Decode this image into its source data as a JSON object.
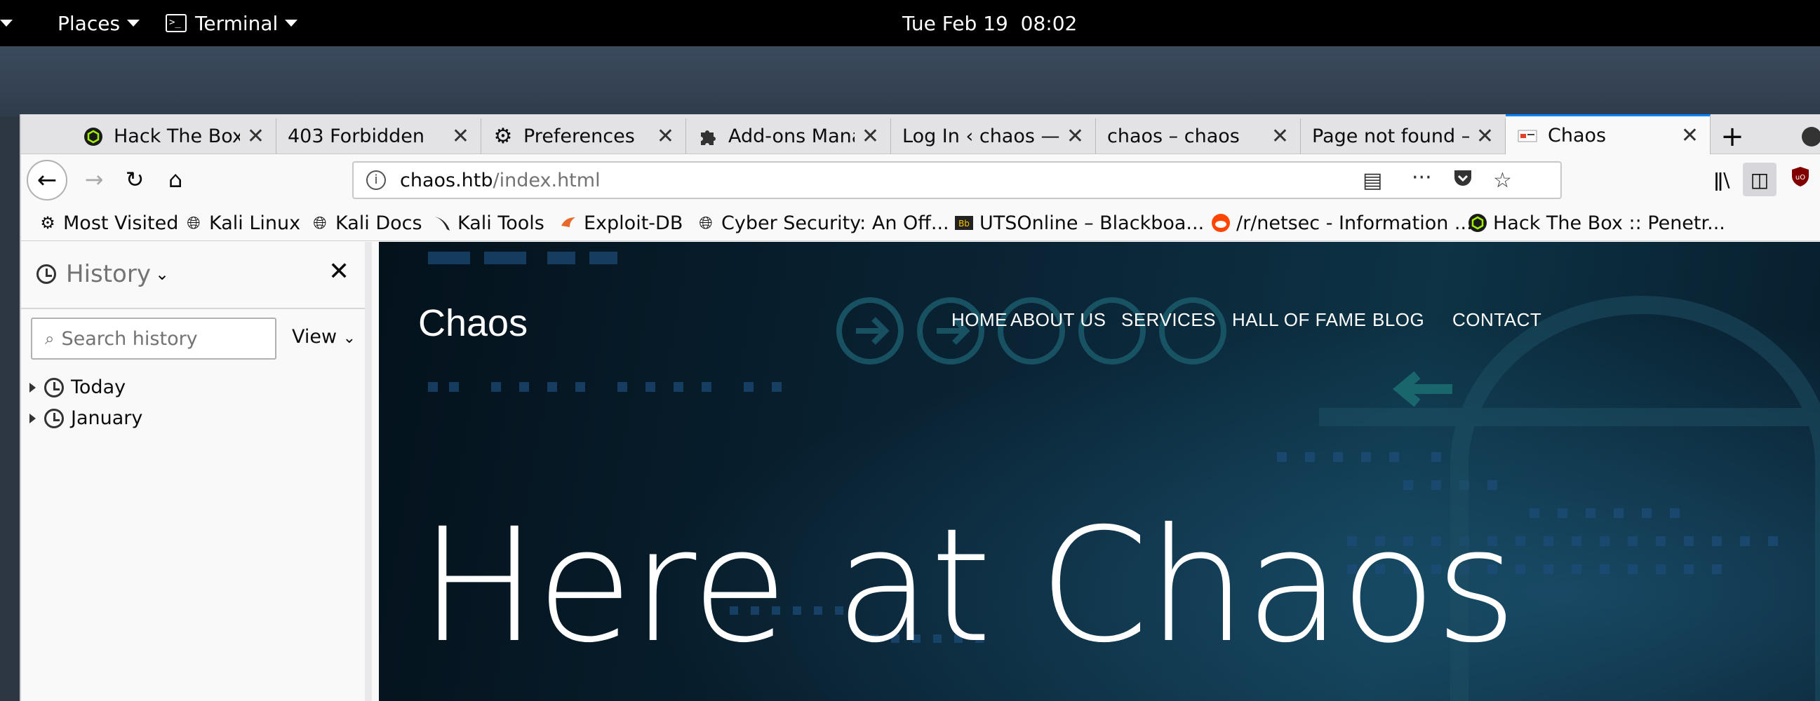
{
  "system_bar": {
    "places_label": "Places",
    "terminal_label": "Terminal",
    "clock": "Tue Feb 19  08:02"
  },
  "browser": {
    "tabs": [
      {
        "label": "Hack The Box ::",
        "icon": "hackthebox-icon"
      },
      {
        "label": "403 Forbidden",
        "icon": ""
      },
      {
        "label": "Preferences",
        "icon": "gear-icon"
      },
      {
        "label": "Add-ons Manager",
        "icon": "puzzle-icon"
      },
      {
        "label": "Log In ‹ chaos — WordPress",
        "icon": ""
      },
      {
        "label": "chaos – chaos",
        "icon": ""
      },
      {
        "label": "Page not found – chaos",
        "icon": ""
      },
      {
        "label": "Chaos",
        "icon": "chaos-favicon",
        "active": true
      }
    ],
    "url": {
      "host": "chaos.htb",
      "path": "/index.html"
    },
    "bookmarks": [
      {
        "label": "Most Visited",
        "icon": "gear-icon"
      },
      {
        "label": "Kali Linux",
        "icon": "globe-icon"
      },
      {
        "label": "Kali Docs",
        "icon": "globe-icon"
      },
      {
        "label": "Kali Tools",
        "icon": "kali-icon"
      },
      {
        "label": "Exploit-DB",
        "icon": "exploitdb-icon"
      },
      {
        "label": "Cyber Security: An Off...",
        "icon": "globe-icon"
      },
      {
        "label": "UTSOnline – Blackboa...",
        "icon": "blackboard-icon"
      },
      {
        "label": "/r/netsec - Information ...",
        "icon": "reddit-icon"
      },
      {
        "label": "Hack The Box :: Penetr...",
        "icon": "hackthebox-icon"
      }
    ],
    "colors": {
      "accent": "#0a84ff",
      "reddit": "#ff4500",
      "htb": "#9fef00"
    }
  },
  "sidebar": {
    "title": "History",
    "search_placeholder": "Search history",
    "view_label": "View",
    "items": [
      {
        "label": "Today"
      },
      {
        "label": "January"
      }
    ]
  },
  "site": {
    "logo": "Chaos",
    "nav": [
      "HOME",
      "ABOUT US",
      "SERVICES",
      "HALL OF FAME",
      "BLOG",
      "CONTACT"
    ],
    "hero": "Here at Chaos"
  }
}
